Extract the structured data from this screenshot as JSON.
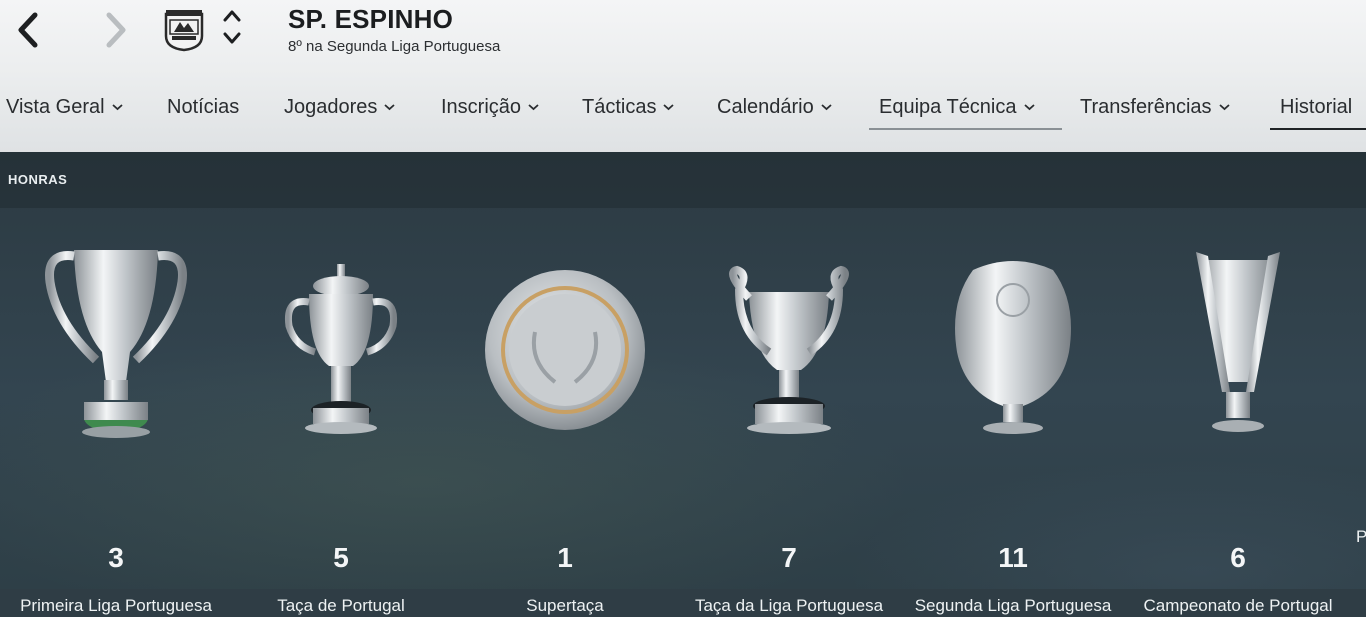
{
  "header": {
    "club_name": "SP. ESPINHO",
    "club_subtitle": "8º na Segunda Liga Portuguesa"
  },
  "tabs": [
    {
      "label": "Vista Geral",
      "dropdown": true
    },
    {
      "label": "Notícias",
      "dropdown": false
    },
    {
      "label": "Jogadores",
      "dropdown": true
    },
    {
      "label": "Inscrição",
      "dropdown": true
    },
    {
      "label": "Tácticas",
      "dropdown": true
    },
    {
      "label": "Calendário",
      "dropdown": true
    },
    {
      "label": "Equipa Técnica",
      "dropdown": true,
      "hover": true
    },
    {
      "label": "Transferências",
      "dropdown": true
    },
    {
      "label": "Historial",
      "dropdown": false,
      "active": true
    }
  ],
  "section": {
    "title": "HONRAS"
  },
  "honours": [
    {
      "count": "3",
      "name": "Primeira Liga Portuguesa",
      "icon": "league-cup-trophy-icon"
    },
    {
      "count": "5",
      "name": "Taça de Portugal",
      "icon": "lidded-cup-trophy-icon"
    },
    {
      "count": "1",
      "name": "Supertaça",
      "icon": "silver-plate-trophy-icon"
    },
    {
      "count": "7",
      "name": "Taça da Liga Portuguesa",
      "icon": "handled-cup-trophy-icon"
    },
    {
      "count": "11",
      "name": "Segunda Liga Portuguesa",
      "icon": "shield-trophy-icon"
    },
    {
      "count": "6",
      "name": "Campeonato de Portugal",
      "icon": "modern-cup-trophy-icon"
    }
  ],
  "partial_label": "P",
  "colors": {
    "header_bg": "#eceeef",
    "content_bg": "#2f3d45",
    "text_light": "#f4f6f7",
    "accent_underline": "#1f2326",
    "hover_underline": "#8a9095",
    "plate_ring": "#c8a064"
  }
}
